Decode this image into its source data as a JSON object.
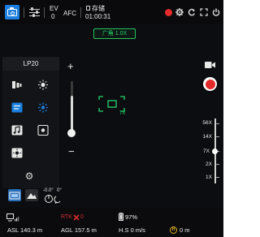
{
  "topbar": {
    "ev_label": "EV",
    "ev_value": "0",
    "focus_mode": "AFC",
    "storage_label": "存储",
    "storage_time": "01:00:31"
  },
  "mode_chip": "广角 1.0X",
  "left_panel": {
    "title": "LP20"
  },
  "zoom": {
    "plus": "+",
    "minus": "−",
    "reticle_zoom": "7X",
    "scale_labels": [
      "56X",
      "14X",
      "7X",
      "2X",
      "1X"
    ],
    "current": "7X"
  },
  "gimbal": {
    "pitch": "-0.0°",
    "yaw": "0°"
  },
  "status": {
    "rtk_label": "RTK",
    "rtk_value": "0",
    "battery": "97%",
    "asl": "ASL 140.3 m",
    "agl": "AGL 157.5 m",
    "hs": "H.S 0 m/s",
    "home_distance": "0 m",
    "home_badge": "H"
  },
  "colors": {
    "accent_blue": "#1a7fe0",
    "accent_green": "#23d36a",
    "record_red": "#e12a2a",
    "warning_yellow": "#e3b21d"
  }
}
